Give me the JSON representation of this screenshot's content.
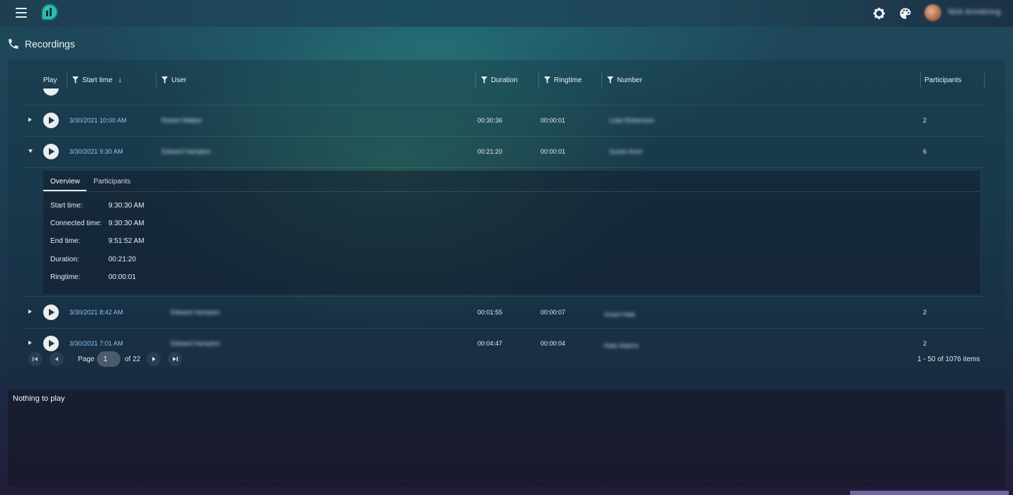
{
  "header": {
    "user_name": "Nick Armstrong"
  },
  "page": {
    "title": "Recordings"
  },
  "table": {
    "columns": {
      "play": "Play",
      "start_time": "Start time",
      "user": "User",
      "duration": "Duration",
      "ringtime": "Ringtime",
      "number": "Number",
      "participants": "Participants"
    },
    "rows": [
      {
        "start": "3/30/2021 10:00 AM",
        "user": "Robert Walker",
        "duration": "00:30:36",
        "ringtime": "00:00:01",
        "number": "Luke Robertson",
        "participants": "2"
      },
      {
        "start": "3/30/2021 9:30 AM",
        "user": "Edward Hampton",
        "duration": "00:21:20",
        "ringtime": "00:00:01",
        "number": "Susan Kent",
        "participants": "6"
      },
      {
        "start": "3/30/2021 8:42 AM",
        "user": "Edward Hampton",
        "duration": "00:01:55",
        "ringtime": "00:00:07",
        "number": "Grant Hale",
        "participants": "2"
      },
      {
        "start": "3/30/2021 7:01 AM",
        "user": "Edward Hampton",
        "duration": "00:04:47",
        "ringtime": "00:00:04",
        "number": "Kate Adams",
        "participants": "2"
      }
    ],
    "detail": {
      "tabs": [
        "Overview",
        "Participants"
      ],
      "fields": [
        {
          "label": "Start time:",
          "value": "9:30:30 AM"
        },
        {
          "label": "Connected time:",
          "value": "9:30:30 AM"
        },
        {
          "label": "End time:",
          "value": "9:51:52 AM"
        },
        {
          "label": "Duration:",
          "value": "00:21:20"
        },
        {
          "label": "Ringtime:",
          "value": "00:00:01"
        }
      ]
    }
  },
  "pager": {
    "page_label": "Page",
    "current_page": "1",
    "of_label": "of 22",
    "items_info": "1 - 50 of 1076 items"
  },
  "player": {
    "message": "Nothing to play"
  }
}
